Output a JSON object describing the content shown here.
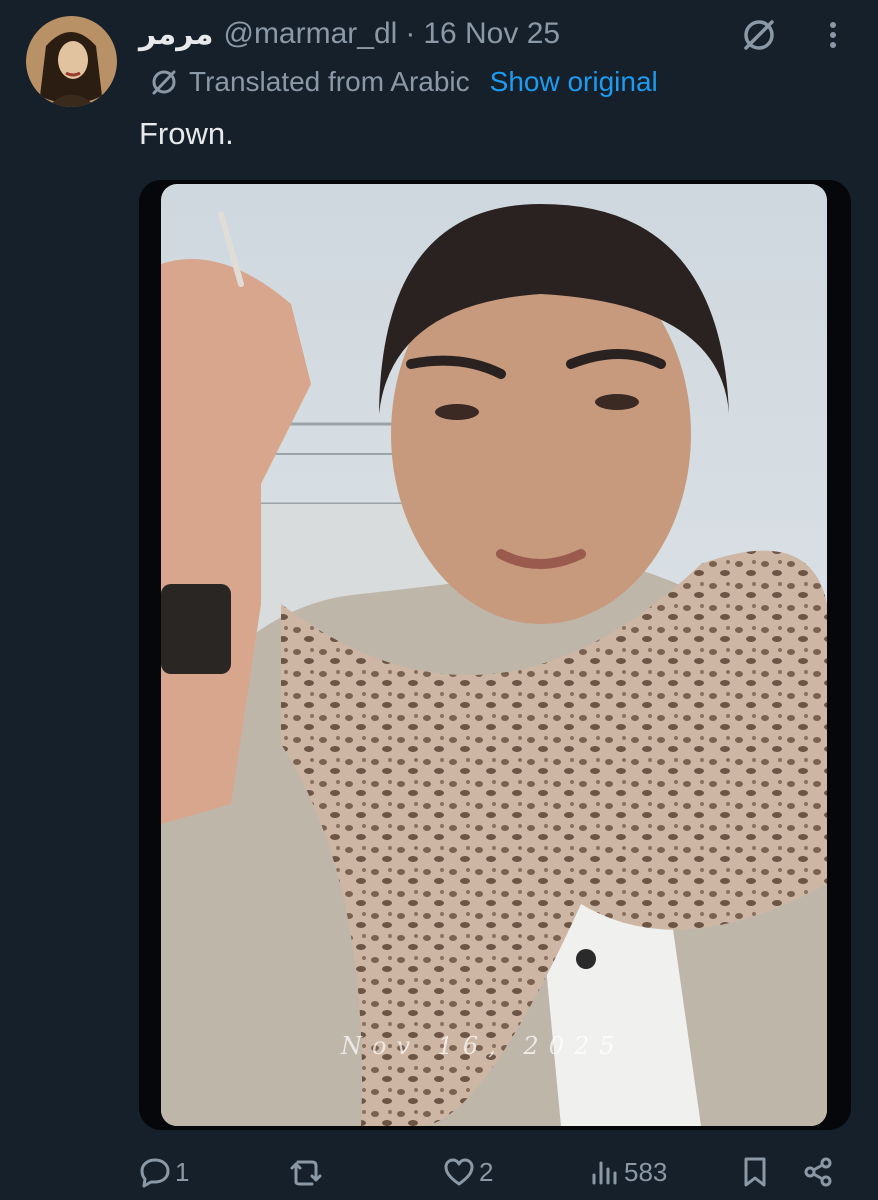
{
  "post": {
    "display_name": "مرمر",
    "handle": "@marmar_dl",
    "separator": "·",
    "date": "16 Nov 25",
    "translation_label": "Translated from Arabic",
    "show_original_label": "Show original",
    "text": "Frown.",
    "media": {
      "watermark": "Nov 16, 2025"
    }
  },
  "actions": {
    "reply_count": "1",
    "repost_count": "",
    "like_count": "2",
    "views_count": "583"
  },
  "icons": {
    "grok": "grok-icon",
    "more": "more-vertical-icon",
    "translate": "translate-icon",
    "reply": "reply-icon",
    "repost": "repost-icon",
    "like": "heart-icon",
    "views": "views-icon",
    "bookmark": "bookmark-icon",
    "share": "share-icon"
  },
  "colors": {
    "background": "#15202b",
    "text": "#e7e9ea",
    "muted": "#8b98a5",
    "link": "#1d9bf0"
  }
}
